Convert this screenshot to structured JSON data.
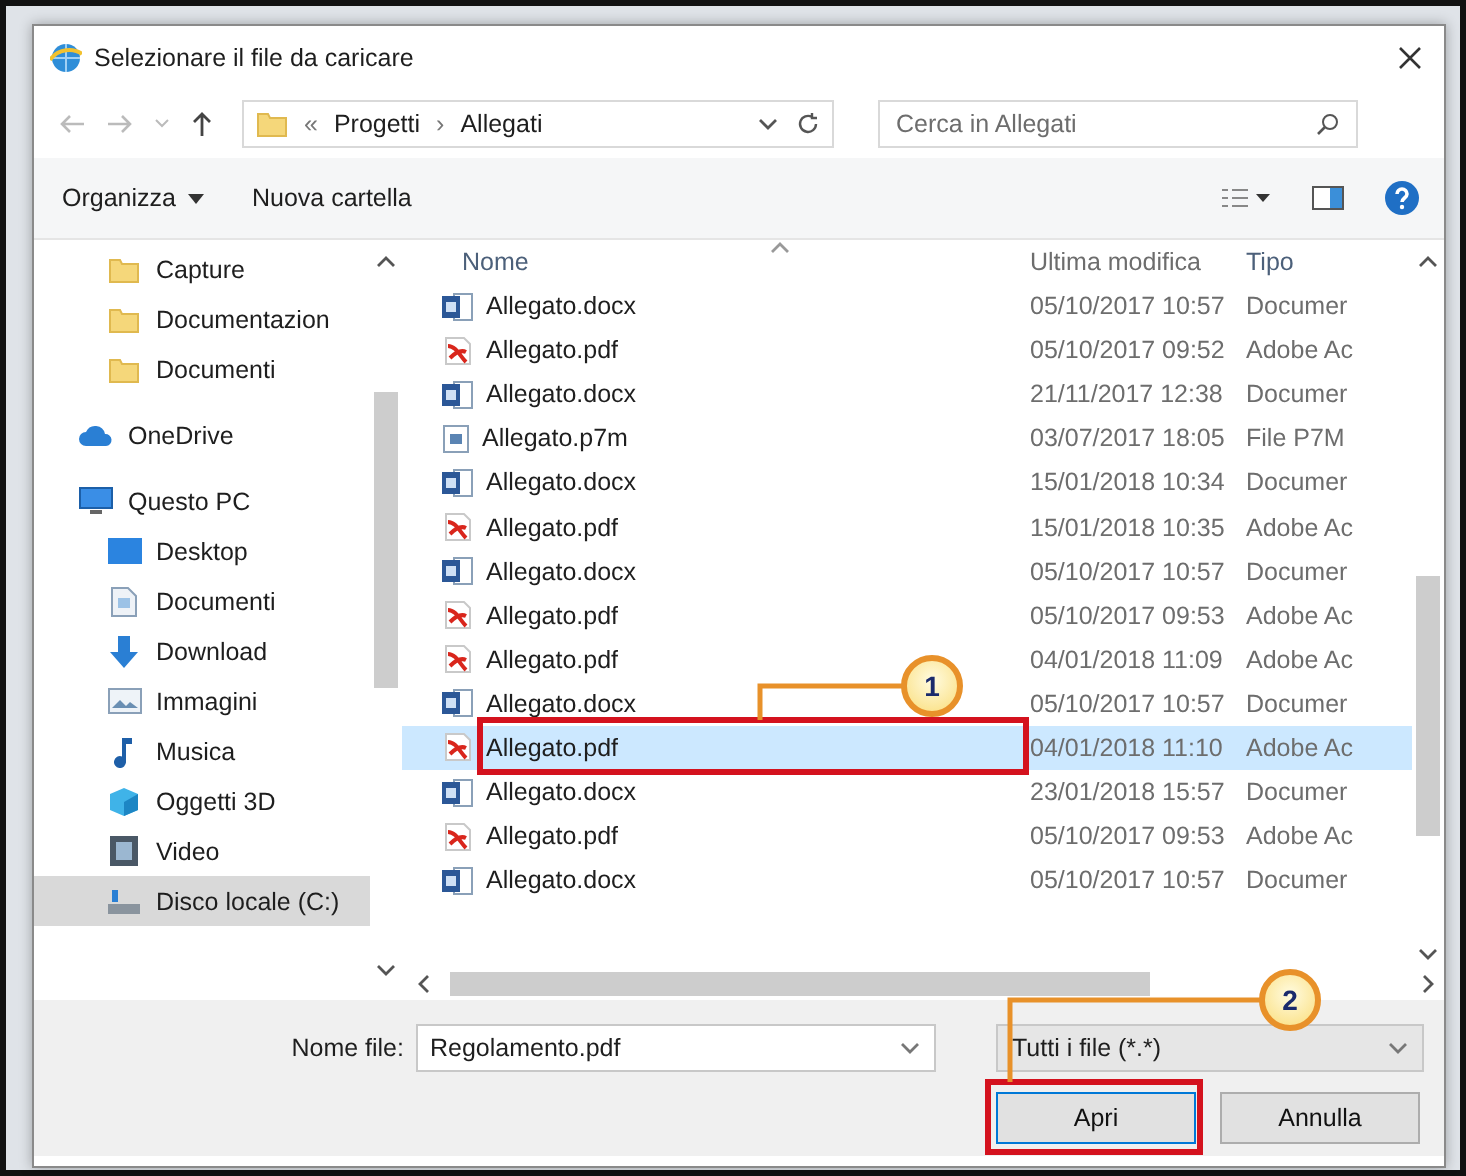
{
  "window": {
    "title": "Selezionare il file da caricare"
  },
  "address": {
    "overflow": "«",
    "crumbs": [
      "Progetti",
      "Allegati"
    ],
    "separator": "›"
  },
  "search": {
    "placeholder": "Cerca in Allegati"
  },
  "toolbar": {
    "buttons": [
      {
        "label": "Organizza",
        "kind": "menu"
      },
      {
        "label": "Nuova cartella",
        "kind": "plain"
      }
    ]
  },
  "sidebar": {
    "items": [
      {
        "label": "Capture",
        "kind": "folder",
        "selected": false
      },
      {
        "label": "Documentazion",
        "kind": "folder",
        "selected": false
      },
      {
        "label": "Documenti",
        "kind": "folder",
        "selected": false
      },
      {
        "label": "OneDrive",
        "kind": "cloud",
        "selected": false
      },
      {
        "label": "Questo PC",
        "kind": "pc",
        "selected": false,
        "children": [
          {
            "label": "Desktop",
            "kind": "desktop",
            "selected": false
          },
          {
            "label": "Documenti",
            "kind": "document",
            "selected": false
          },
          {
            "label": "Download",
            "kind": "download",
            "selected": false
          },
          {
            "label": "Immagini",
            "kind": "images",
            "selected": false
          },
          {
            "label": "Musica",
            "kind": "music",
            "selected": false
          },
          {
            "label": "Oggetti 3D",
            "kind": "cube",
            "selected": false
          },
          {
            "label": "Video",
            "kind": "video",
            "selected": false
          },
          {
            "label": "Disco locale (C:)",
            "kind": "drive",
            "selected": true
          }
        ]
      }
    ]
  },
  "files": {
    "columns": [
      "Nome",
      "Ultima modifica",
      "Tipo"
    ],
    "rows": [
      {
        "name": "Allegato.docx",
        "kind": "docx",
        "modified": "05/10/2017 10:57",
        "type": "Documer",
        "selected": false
      },
      {
        "name": "Allegato.pdf",
        "kind": "pdf",
        "modified": "05/10/2017 09:52",
        "type": "Adobe Ac",
        "selected": false
      },
      {
        "name": "Allegato.docx",
        "kind": "docx",
        "modified": "21/11/2017 12:38",
        "type": "Documer",
        "selected": false
      },
      {
        "name": "Allegato.p7m",
        "kind": "p7m",
        "modified": "03/07/2017 18:05",
        "type": "File P7M",
        "selected": false
      },
      {
        "name": "Allegato.docx",
        "kind": "docx",
        "modified": "15/01/2018 10:34",
        "type": "Documer",
        "selected": false
      },
      {
        "name": "Allegato.pdf",
        "kind": "pdf",
        "modified": "15/01/2018 10:35",
        "type": "Adobe Ac",
        "selected": false
      },
      {
        "name": "Allegato.docx",
        "kind": "docx",
        "modified": "05/10/2017 10:57",
        "type": "Documer",
        "selected": false
      },
      {
        "name": "Allegato.pdf",
        "kind": "pdf",
        "modified": "05/10/2017 09:53",
        "type": "Adobe Ac",
        "selected": false
      },
      {
        "name": "Allegato.pdf",
        "kind": "pdf",
        "modified": "04/01/2018 11:09",
        "type": "Adobe Ac",
        "selected": false
      },
      {
        "name": "Allegato.docx",
        "kind": "docx",
        "modified": "05/10/2017 10:57",
        "type": "Documer",
        "selected": false
      },
      {
        "name": "Allegato.pdf",
        "kind": "pdf",
        "modified": "04/01/2018 11:10",
        "type": "Adobe Ac",
        "selected": true
      },
      {
        "name": "Allegato.docx",
        "kind": "docx",
        "modified": "23/01/2018 15:57",
        "type": "Documer",
        "selected": false
      },
      {
        "name": "Allegato.pdf",
        "kind": "pdf",
        "modified": "05/10/2017 09:53",
        "type": "Adobe Ac",
        "selected": false
      },
      {
        "name": "Allegato.docx",
        "kind": "docx",
        "modified": "05/10/2017 10:57",
        "type": "Documer",
        "selected": false
      }
    ]
  },
  "footer": {
    "filename_label": "Nome file:",
    "filename": "Regolamento.pdf",
    "filter": "Tutti i file (*.*)",
    "buttons": [
      {
        "label": "Apri",
        "kind": "primary"
      },
      {
        "label": "Annulla",
        "kind": "cancel"
      }
    ]
  },
  "callouts": [
    {
      "number": "1"
    },
    {
      "number": "2"
    }
  ]
}
